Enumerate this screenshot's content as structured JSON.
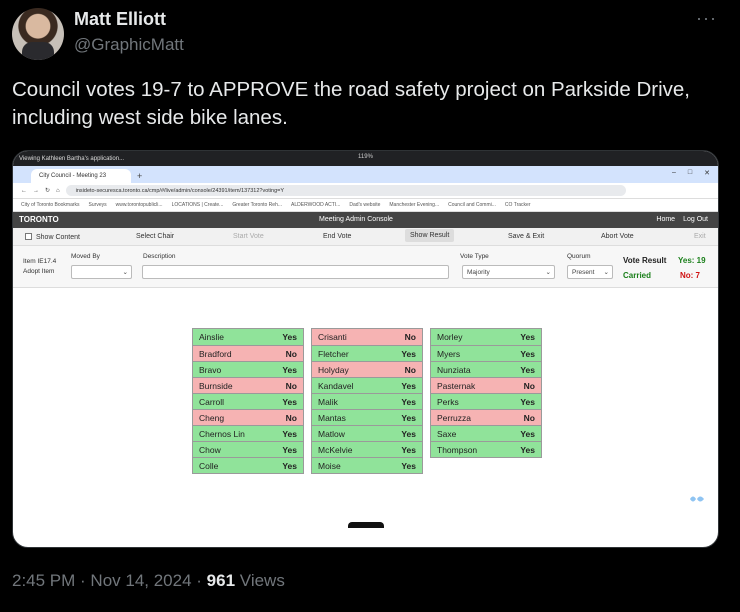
{
  "tweet": {
    "author_name": "Matt Elliott",
    "handle": "@GraphicMatt",
    "more": "···",
    "text": "Council votes 19-7 to APPROVE the road safety project on Parkside Drive, including west side bike lanes.",
    "time": "2:45 PM · Nov 14, 2024 ·",
    "views_count": "961",
    "views_label": "Views"
  },
  "browser": {
    "sharing_text": "Viewing Kathleen Bartha's application...",
    "zoom": "119%",
    "tab_title": "City Council - Meeting 23",
    "url": "insideto-securesca.toronto.ca/cmp/#/live/admin/console/24391/item/137312?voting=Y",
    "window_controls": [
      "–",
      "□",
      "✕"
    ],
    "bookmarks": [
      "City of Toronto Bookmarks",
      "Surveys",
      "www.torontopublicli...",
      "LOCATIONS | Create...",
      "Greater Toronto Reh...",
      "ALDERWOOD ACTI...",
      "Dad's website",
      "Manchester Evening...",
      "Council and Commi...",
      "CO Tracker"
    ]
  },
  "app": {
    "logo": "TORONTO",
    "title": "Meeting Admin Console",
    "home": "Home",
    "logout": "Log Out"
  },
  "toolbar": {
    "show_content": "Show Content",
    "select_chair": "Select Chair",
    "start_vote": "Start Vote",
    "end_vote": "End Vote",
    "show_result": "Show Result",
    "save_exit": "Save & Exit",
    "abort_vote": "Abort Vote",
    "exit": "Exit"
  },
  "item": {
    "item_no": "Item IE17.4",
    "action": "Adopt Item",
    "moved_by_label": "Moved By",
    "description_label": "Description",
    "vote_type_label": "Vote Type",
    "vote_type_value": "Majority",
    "quorum_label": "Quorum",
    "quorum_value": "Present",
    "vote_result_label": "Vote Result",
    "vote_result_status": "Carried",
    "yes_count": "Yes: 19",
    "no_count": "No: 7"
  },
  "colors": {
    "yes": "#90e39a",
    "no": "#f6b3b3"
  },
  "votes": {
    "col1": [
      {
        "name": "Ainslie",
        "vote": "Yes"
      },
      {
        "name": "Bradford",
        "vote": "No"
      },
      {
        "name": "Bravo",
        "vote": "Yes"
      },
      {
        "name": "Burnside",
        "vote": "No"
      },
      {
        "name": "Carroll",
        "vote": "Yes"
      },
      {
        "name": "Cheng",
        "vote": "No"
      },
      {
        "name": "Chernos Lin",
        "vote": "Yes"
      },
      {
        "name": "Chow",
        "vote": "Yes"
      },
      {
        "name": "Colle",
        "vote": "Yes"
      }
    ],
    "col2": [
      {
        "name": "Crisanti",
        "vote": "No"
      },
      {
        "name": "Fletcher",
        "vote": "Yes"
      },
      {
        "name": "Holyday",
        "vote": "No"
      },
      {
        "name": "Kandavel",
        "vote": "Yes"
      },
      {
        "name": "Malik",
        "vote": "Yes"
      },
      {
        "name": "Mantas",
        "vote": "Yes"
      },
      {
        "name": "Matlow",
        "vote": "Yes"
      },
      {
        "name": "McKelvie",
        "vote": "Yes"
      },
      {
        "name": "Moise",
        "vote": "Yes"
      }
    ],
    "col3": [
      {
        "name": "Morley",
        "vote": "Yes"
      },
      {
        "name": "Myers",
        "vote": "Yes"
      },
      {
        "name": "Nunziata",
        "vote": "Yes"
      },
      {
        "name": "Pasternak",
        "vote": "No"
      },
      {
        "name": "Perks",
        "vote": "Yes"
      },
      {
        "name": "Perruzza",
        "vote": "No"
      },
      {
        "name": "Saxe",
        "vote": "Yes"
      },
      {
        "name": "Thompson",
        "vote": "Yes"
      }
    ]
  }
}
